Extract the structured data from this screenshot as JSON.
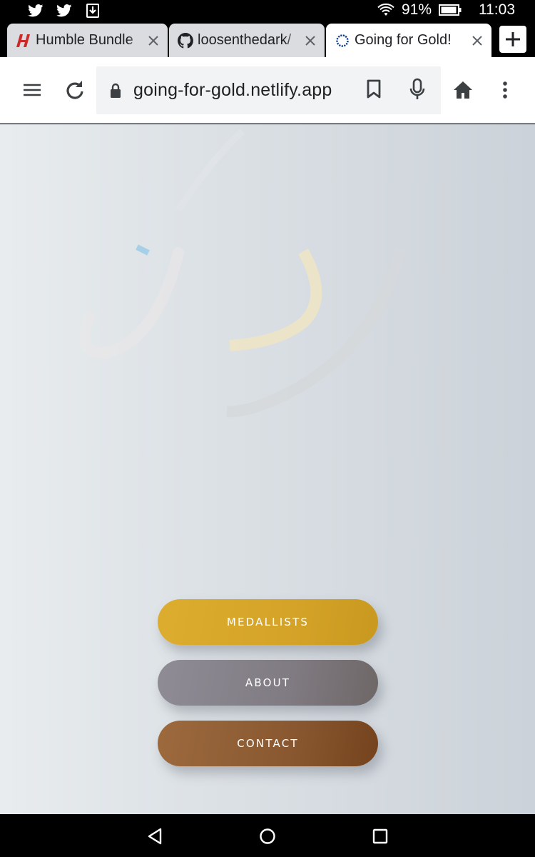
{
  "status": {
    "left_icons": [
      "twitter-icon",
      "twitter-icon",
      "download-icon"
    ],
    "battery": "91%",
    "time": "11:03"
  },
  "tabs": [
    {
      "title": "Humble Bundle",
      "icon": "humble-bundle-icon",
      "active": false
    },
    {
      "title": "loosenthedark/",
      "icon": "github-icon",
      "active": false
    },
    {
      "title": "Going for Gold!",
      "icon": "olympic-rings-icon",
      "active": true
    }
  ],
  "toolbar": {
    "url": "going-for-gold.netlify.app"
  },
  "menu": {
    "medallists": "MEDALLISTS",
    "about": "ABOUT",
    "contact": "CONTACT"
  },
  "colors": {
    "gold": "#d4a328",
    "silver": "#807b82",
    "bronze": "#8a5830",
    "page_bg": "#dde2e6"
  }
}
